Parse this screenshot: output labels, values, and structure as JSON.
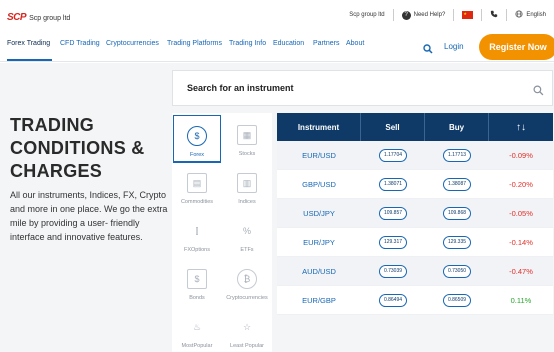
{
  "brand": {
    "logo_mark": "SCP",
    "name": "Scp group ltd"
  },
  "topbar": {
    "company": "Scp group ltd",
    "help_icon": "question-icon",
    "help": "Need Help?",
    "flag_icon": "china-flag-icon",
    "phone_icon": "phone-icon",
    "globe_icon": "globe-icon",
    "language": "English"
  },
  "nav": {
    "items": [
      "Forex Trading",
      "CFD Trading",
      "Cryptocurrencies",
      "Trading Platforms",
      "Trading Info",
      "Education",
      "Partners",
      "About"
    ],
    "login": "Login",
    "register": "Register Now",
    "accent_color": "#1767b5",
    "register_color": "#f39200"
  },
  "hero": {
    "title_lines": [
      "TRADING",
      "CONDITIONS &",
      "CHARGES"
    ],
    "description": "All our instruments, Indices, FX, Crypto and more in one place. We go the extra mile by providing a user- friendly interface and innovative features."
  },
  "search": {
    "placeholder": "Search for an instrument",
    "icon": "search-icon"
  },
  "categories": [
    {
      "label": "Forex",
      "icon": "forex-icon",
      "active": true
    },
    {
      "label": "Stocks",
      "icon": "stocks-icon",
      "active": false
    },
    {
      "label": "Commodities",
      "icon": "commodities-icon",
      "active": false
    },
    {
      "label": "Indices",
      "icon": "indices-icon",
      "active": false
    },
    {
      "label": "FXOptions",
      "icon": "fxoptions-icon",
      "active": false
    },
    {
      "label": "ETFs",
      "icon": "etfs-icon",
      "active": false
    },
    {
      "label": "Bonds",
      "icon": "bonds-icon",
      "active": false
    },
    {
      "label": "Cryptocurrencies",
      "icon": "crypto-icon",
      "active": false
    },
    {
      "label": "MostPopular",
      "icon": "fire-icon",
      "active": false
    },
    {
      "label": "Least Popular",
      "icon": "star-icon",
      "active": false
    }
  ],
  "quotes": {
    "headers": {
      "instrument": "Instrument",
      "sell": "Sell",
      "buy": "Buy",
      "change": "↑↓"
    },
    "rows": [
      {
        "instrument": "EUR/USD",
        "sell": "1.17704",
        "buy": "1.17713",
        "change": "-0.09%",
        "direction": "down"
      },
      {
        "instrument": "GBP/USD",
        "sell": "1.38071",
        "buy": "1.38087",
        "change": "-0.20%",
        "direction": "down"
      },
      {
        "instrument": "USD/JPY",
        "sell": "109.857",
        "buy": "109.868",
        "change": "-0.05%",
        "direction": "down"
      },
      {
        "instrument": "EUR/JPY",
        "sell": "129.317",
        "buy": "129.335",
        "change": "-0.14%",
        "direction": "down"
      },
      {
        "instrument": "AUD/USD",
        "sell": "0.73039",
        "buy": "0.73050",
        "change": "-0.47%",
        "direction": "down"
      },
      {
        "instrument": "EUR/GBP",
        "sell": "0.86494",
        "buy": "0.86509",
        "change": "0.11%",
        "direction": "up"
      }
    ],
    "header_color": "#0f3a68",
    "negative_color": "#e0302a",
    "positive_color": "#2aa52e"
  }
}
